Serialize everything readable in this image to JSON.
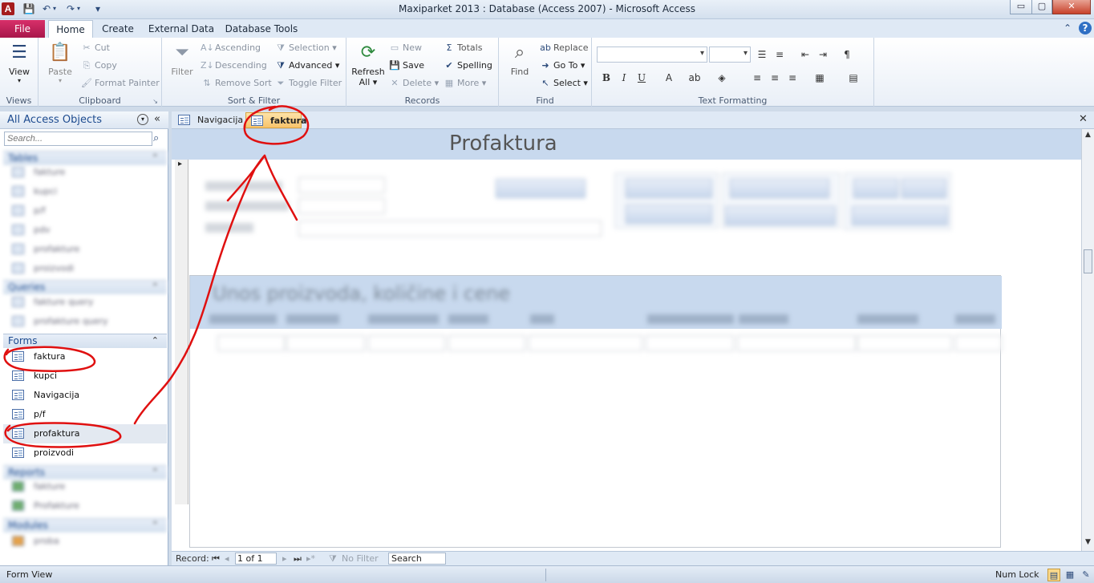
{
  "window": {
    "title": "Maxiparket 2013 : Database (Access 2007)  -  Microsoft Access",
    "min_label": "▭",
    "max_label": "▢",
    "close_label": "✕"
  },
  "ribbon_tabs": [
    "File",
    "Home",
    "Create",
    "External Data",
    "Database Tools"
  ],
  "ribbon": {
    "views": {
      "label": "Views",
      "view": "View"
    },
    "clipboard": {
      "label": "Clipboard",
      "paste": "Paste",
      "cut": "Cut",
      "copy": "Copy",
      "format_painter": "Format Painter"
    },
    "sort_filter": {
      "label": "Sort & Filter",
      "filter": "Filter",
      "ascending": "Ascending",
      "descending": "Descending",
      "remove_sort": "Remove Sort",
      "selection": "Selection",
      "advanced": "Advanced",
      "toggle_filter": "Toggle Filter"
    },
    "records": {
      "label": "Records",
      "refresh": "Refresh",
      "refresh_all": "All",
      "new": "New",
      "save": "Save",
      "delete": "Delete",
      "totals": "Totals",
      "spelling": "Spelling",
      "more": "More"
    },
    "find": {
      "label": "Find",
      "find": "Find",
      "replace": "Replace",
      "goto": "Go To",
      "select": "Select"
    },
    "text_formatting": {
      "label": "Text Formatting",
      "bold": "B",
      "italic": "I",
      "underline": "U"
    }
  },
  "nav": {
    "title": "All Access Objects",
    "search_placeholder": "Search...",
    "groups": {
      "tables": "Tables",
      "queries": "Queries",
      "forms": "Forms",
      "reports": "Reports",
      "modules": "Modules"
    },
    "tables": [
      "fakture",
      "kupci",
      "p/f",
      "pdv",
      "profakture",
      "proizvodi"
    ],
    "queries": [
      "fakture query",
      "profakture query"
    ],
    "forms": [
      "faktura",
      "kupci",
      "Navigacija",
      "p/f",
      "profaktura",
      "proizvodi"
    ],
    "reports": [
      "fakture",
      "Profakture"
    ],
    "modules": [
      "proba"
    ]
  },
  "doc_tabs": [
    "Navigacija",
    "faktura"
  ],
  "form": {
    "title": "Profaktura",
    "subform_title": "Unos proizvoda, količine i cene"
  },
  "record_nav": {
    "label": "Record:",
    "position": "1 of 1",
    "no_filter": "No Filter",
    "search": "Search"
  },
  "status": {
    "left": "Form View",
    "num_lock": "Num Lock"
  },
  "colors": {
    "file_tab": "#c21c55",
    "annotation": "#e01010",
    "form_header": "#c8d9ee"
  }
}
